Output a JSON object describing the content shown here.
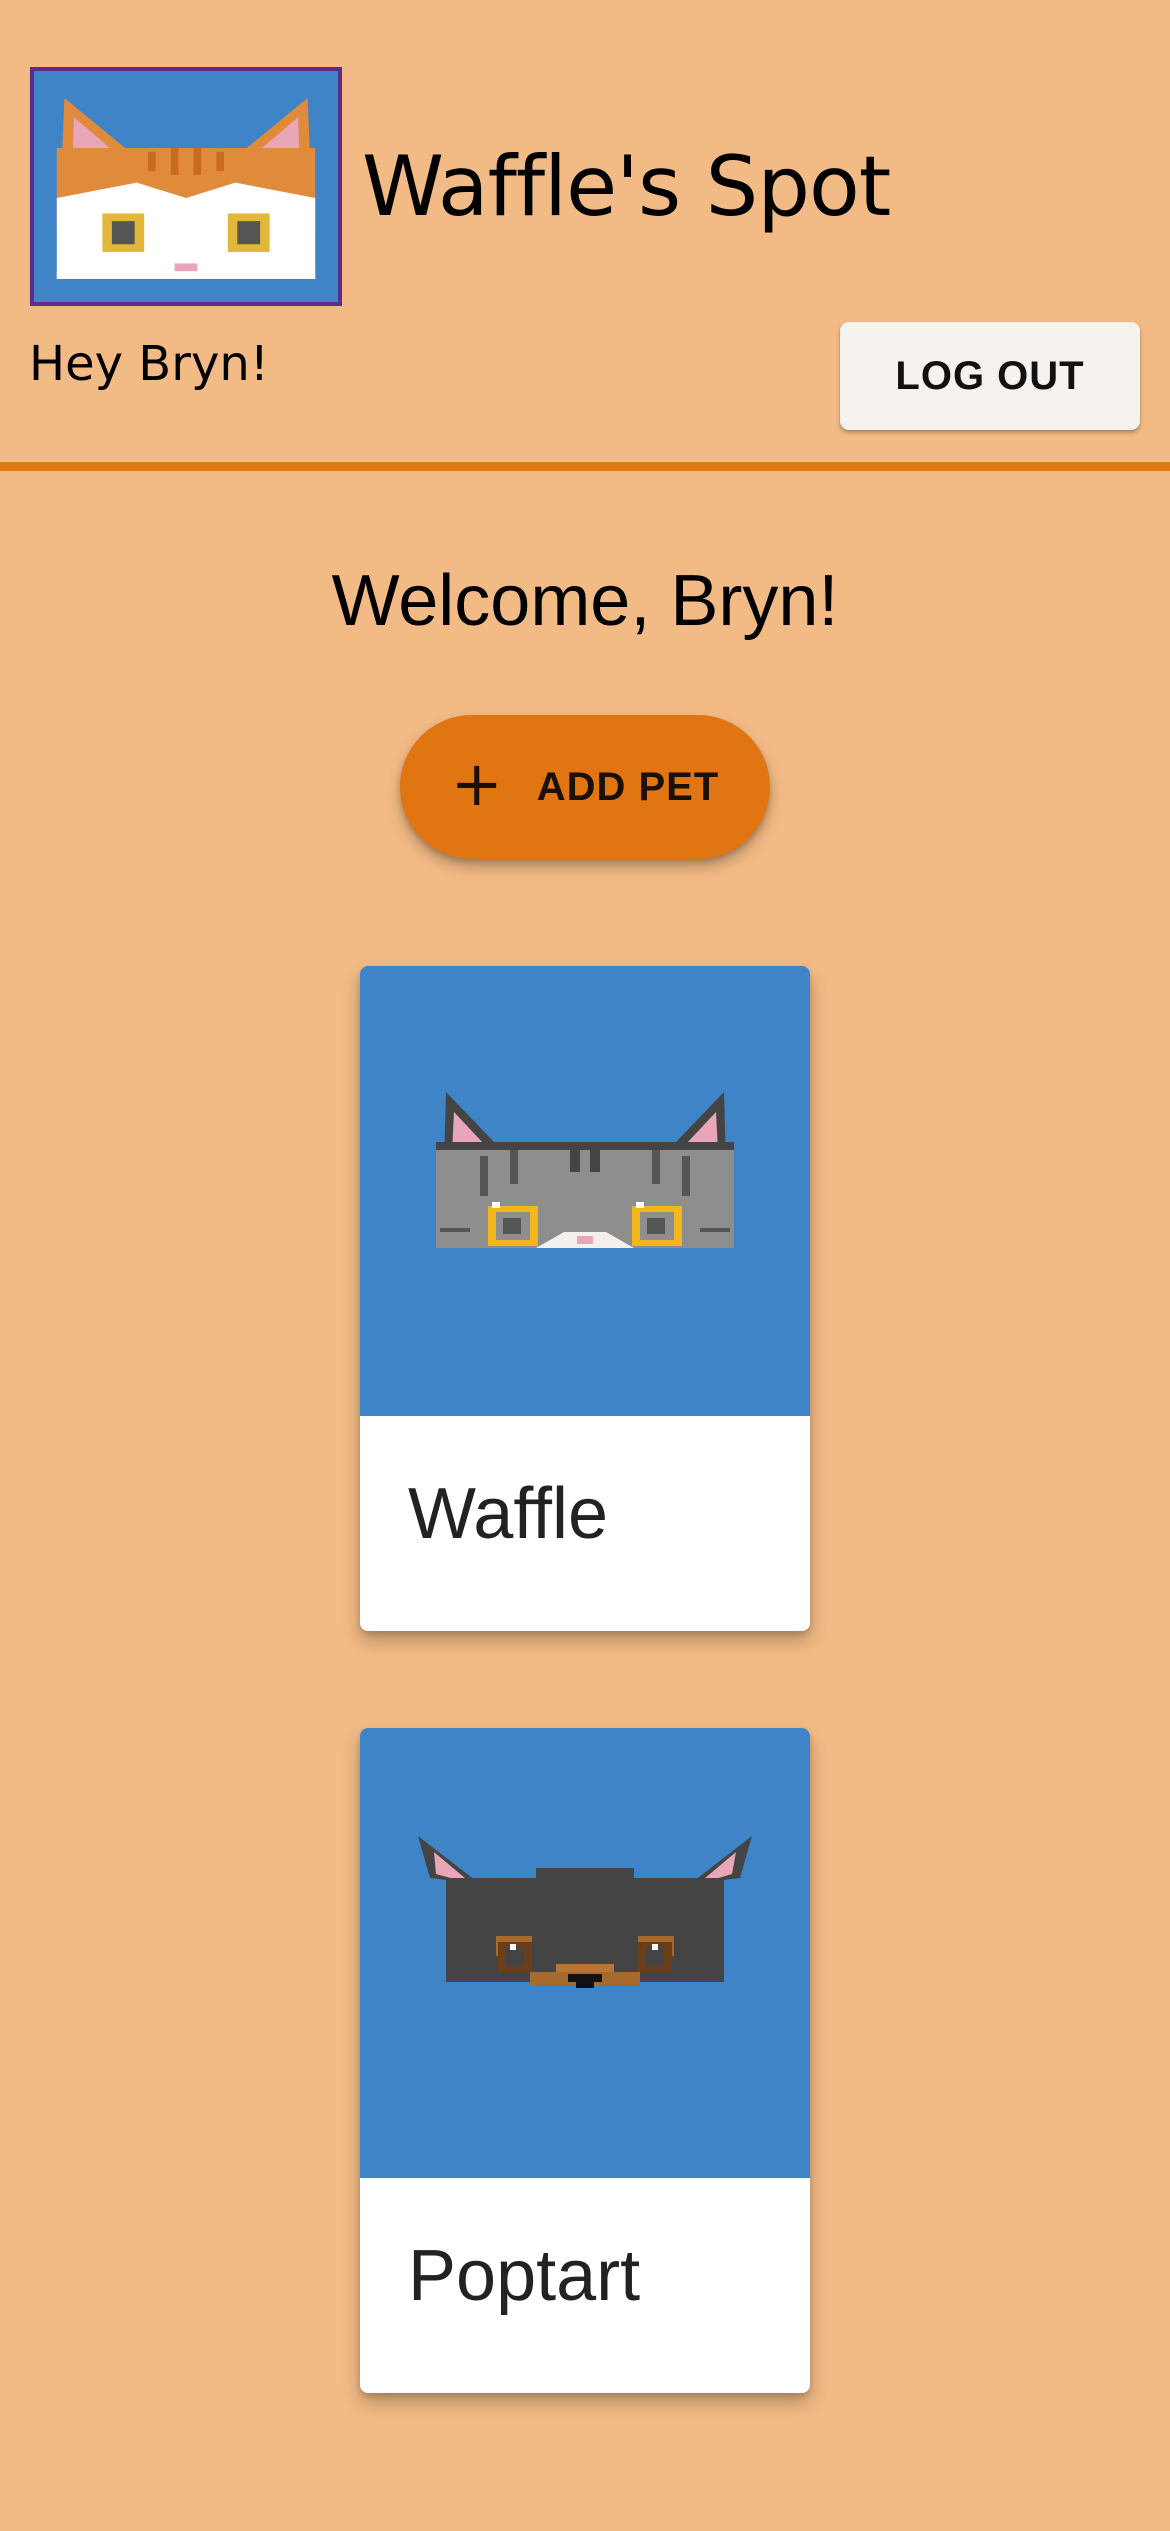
{
  "header": {
    "logo_icon": "orange-white-cat-face-icon",
    "site_title": "Waffle's Spot",
    "greeting": "Hey Bryn!",
    "logout_label": "LOG OUT"
  },
  "main": {
    "welcome": "Welcome, Bryn!",
    "add_pet": {
      "icon": "plus-icon",
      "icon_glyph": "+",
      "label": "ADD PET"
    },
    "pets": [
      {
        "name": "Waffle",
        "avatar_icon": "gray-tabby-cat-face-icon"
      },
      {
        "name": "Poptart",
        "avatar_icon": "black-tan-dog-face-icon"
      }
    ]
  },
  "colors": {
    "background": "#F2BA85",
    "accent": "#E07512",
    "header_rule": "#E07818",
    "card_media": "#3F84C6",
    "logo_border": "#5B2D8A"
  }
}
